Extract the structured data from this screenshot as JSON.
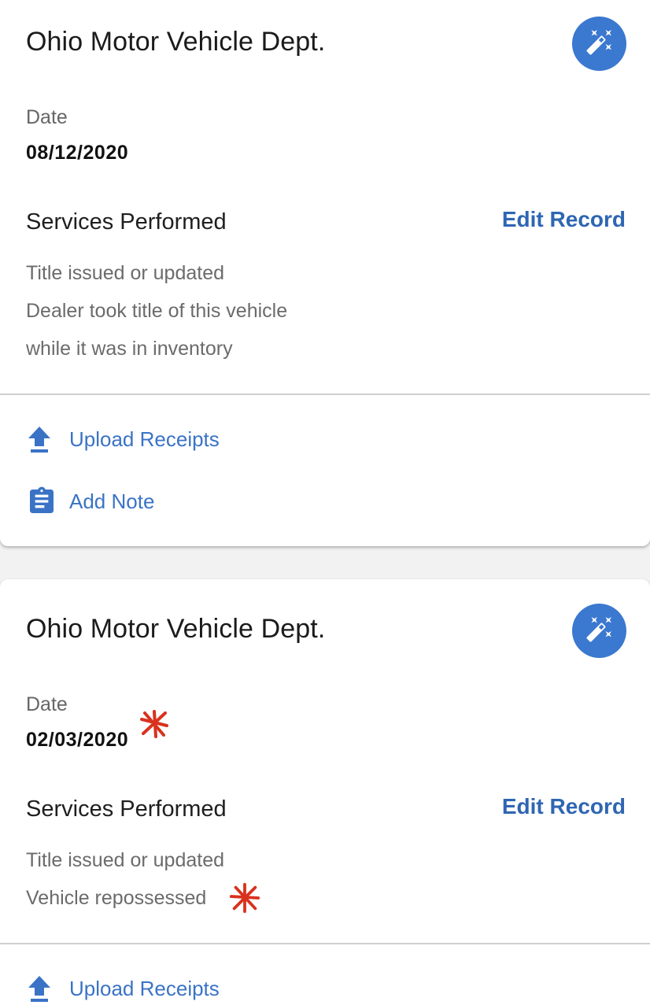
{
  "records": [
    {
      "provider": "Ohio Motor Vehicle Dept.",
      "date_label": "Date",
      "date_value": "08/12/2020",
      "services_heading": "Services Performed",
      "edit_label": "Edit Record",
      "services": [
        "Title issued or updated",
        "Dealer took title of this vehicle",
        "while it was in inventory"
      ],
      "actions": {
        "upload_label": "Upload Receipts",
        "note_label": "Add Note"
      }
    },
    {
      "provider": "Ohio Motor Vehicle Dept.",
      "date_label": "Date",
      "date_value": "02/03/2020",
      "services_heading": "Services Performed",
      "edit_label": "Edit Record",
      "services": [
        "Title issued or updated",
        "Vehicle repossessed"
      ],
      "actions": {
        "upload_label": "Upload Receipts"
      }
    }
  ],
  "icons": {
    "magic": "magic-wand-icon",
    "upload": "upload-icon",
    "note": "clipboard-icon",
    "annotation": "red-asterisk-mark"
  },
  "colors": {
    "accent": "#3b78cf",
    "link": "#2f66b3",
    "annotation": "#d8321e"
  }
}
